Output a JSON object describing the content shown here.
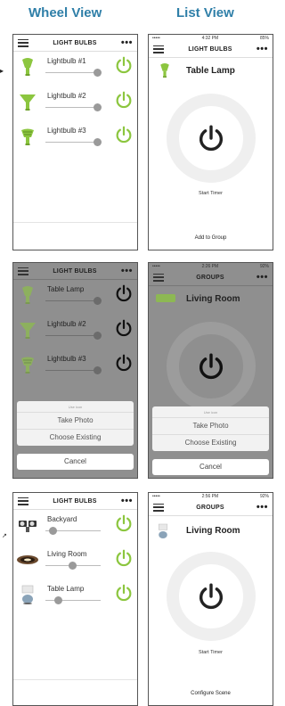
{
  "headers": {
    "left": "Wheel View",
    "right": "List View"
  },
  "colors": {
    "accent_green": "#8cc63f",
    "header_blue": "#2f7fa8"
  },
  "panel1": {
    "nav_title": "LIGHT BULBS",
    "items": [
      {
        "label": "Lightbulb #1",
        "brightness": 0.9,
        "on": true
      },
      {
        "label": "Lightbulb #2",
        "brightness": 0.9,
        "on": true
      },
      {
        "label": "Lightbulb #3",
        "brightness": 0.9,
        "on": true
      }
    ]
  },
  "panel2": {
    "status_time": "4:32 PM",
    "status_battery": "85%",
    "nav_title": "LIGHT BULBS",
    "device": "Table Lamp",
    "start_timer": "Start Timer",
    "add_to_group": "Add to Group"
  },
  "panel3": {
    "nav_title": "LIGHT BULBS",
    "items": [
      {
        "label": "Table Lamp",
        "brightness": 0.9
      },
      {
        "label": "Lightbulb #2",
        "brightness": 0.9
      },
      {
        "label": "Lightbulb #3",
        "brightness": 0.9
      }
    ],
    "sheet_title": "Use icon",
    "take_photo": "Take Photo",
    "choose_existing": "Choose Existing",
    "cancel": "Cancel"
  },
  "panel4": {
    "status_time": "2:26 PM",
    "status_battery": "92%",
    "nav_title": "GROUPS",
    "device": "Living Room",
    "sheet_title": "Use icon",
    "take_photo": "Take Photo",
    "choose_existing": "Choose Existing",
    "cancel": "Cancel"
  },
  "panel5": {
    "nav_title": "LIGHT BULBS",
    "items": [
      {
        "label": "Backyard",
        "brightness": 0.1,
        "on": true
      },
      {
        "label": "Living Room",
        "brightness": 0.45,
        "on": true
      },
      {
        "label": "Table Lamp",
        "brightness": 0.2,
        "on": true
      }
    ]
  },
  "panel6": {
    "status_time": "2:56 PM",
    "status_battery": "92%",
    "nav_title": "GROUPS",
    "device": "Living Room",
    "start_timer": "Start Timer",
    "configure_scene": "Configure Scene"
  }
}
